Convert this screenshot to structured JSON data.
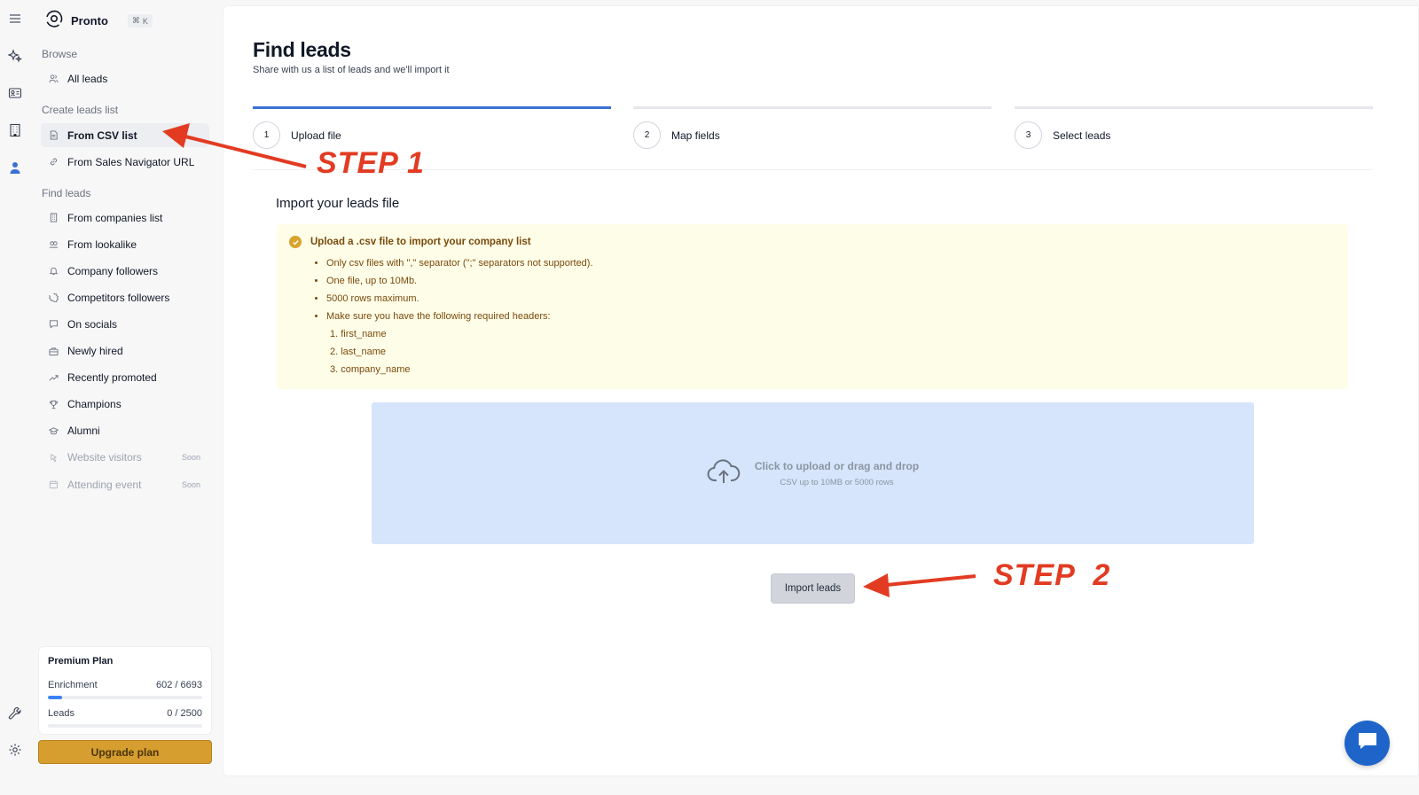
{
  "app": {
    "name": "Pronto",
    "shortcut": "K"
  },
  "sidebar": {
    "browse_title": "Browse",
    "browse_items": [
      {
        "label": "All leads",
        "icon": "users-icon"
      }
    ],
    "create_title": "Create leads list",
    "create_items": [
      {
        "label": "From CSV list",
        "icon": "file-icon",
        "active": true
      },
      {
        "label": "From Sales Navigator URL",
        "icon": "link-icon"
      }
    ],
    "find_title": "Find leads",
    "find_items": [
      {
        "label": "From companies list",
        "icon": "building-icon"
      },
      {
        "label": "From lookalike",
        "icon": "lookalike-icon"
      },
      {
        "label": "Company followers",
        "icon": "bell-icon"
      },
      {
        "label": "Competitors followers",
        "icon": "badge-icon"
      },
      {
        "label": "On socials",
        "icon": "chat-icon"
      },
      {
        "label": "Newly hired",
        "icon": "briefcase-icon"
      },
      {
        "label": "Recently promoted",
        "icon": "trending-up-icon"
      },
      {
        "label": "Champions",
        "icon": "trophy-icon"
      },
      {
        "label": "Alumni",
        "icon": "graduation-cap-icon"
      },
      {
        "label": "Website visitors",
        "icon": "pointer-icon",
        "soon": "Soon"
      },
      {
        "label": "Attending event",
        "icon": "calendar-icon",
        "soon": "Soon"
      }
    ]
  },
  "plan": {
    "title": "Premium Plan",
    "enrichment_label": "Enrichment",
    "enrichment_value": "602 / 6693",
    "enrichment_fraction": 0.09,
    "leads_label": "Leads",
    "leads_value": "0 / 2500",
    "leads_fraction": 0,
    "upgrade_label": "Upgrade plan"
  },
  "page": {
    "title": "Find leads",
    "subtitle": "Share with us a list of leads and we'll import it"
  },
  "steps": [
    {
      "num": "1",
      "label": "Upload file",
      "active": true
    },
    {
      "num": "2",
      "label": "Map fields",
      "active": false
    },
    {
      "num": "3",
      "label": "Select leads",
      "active": false
    }
  ],
  "import": {
    "section_title": "Import your leads file",
    "notice_title": "Upload a .csv file to import your company list",
    "rules": [
      "Only csv files with \",\" separator (\";\" separators not supported).",
      "One file, up to 10Mb.",
      "5000 rows maximum.",
      "Make sure you have the following required headers:"
    ],
    "headers": [
      "1. first_name",
      "2. last_name",
      "3. company_name"
    ],
    "drop_main": "Click to upload or drag and drop",
    "drop_sub": "CSV up to 10MB or 5000 rows",
    "button": "Import leads"
  },
  "annotations": {
    "step1": "STEP 1",
    "step2": "STEP  2",
    "color": "#e23b22"
  },
  "colors": {
    "accent": "#3b6fd4",
    "upgrade": "#d69e2e",
    "notice_bg": "#fefde8",
    "dropzone_bg": "#d6e5fb"
  }
}
